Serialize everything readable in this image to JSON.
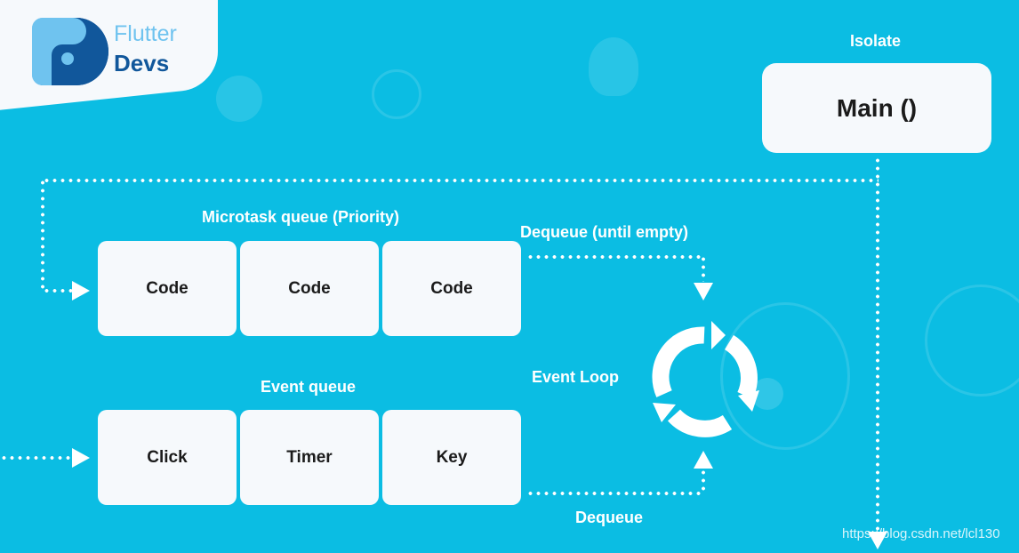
{
  "logo": {
    "line1": "Flutter",
    "line2": "Devs"
  },
  "isolate": {
    "label": "Isolate",
    "main": "Main ()"
  },
  "microtask": {
    "title": "Microtask queue (Priority)",
    "items": [
      "Code",
      "Code",
      "Code"
    ],
    "dequeue_label": "Dequeue (until empty)"
  },
  "event": {
    "title": "Event queue",
    "items": [
      "Click",
      "Timer",
      "Key"
    ],
    "dequeue_label": "Dequeue"
  },
  "event_loop": {
    "label": "Event Loop"
  },
  "watermark": "https://blog.csdn.net/lcl130",
  "colors": {
    "background": "#0bbde3",
    "box": "#f6f9fc",
    "logo_dark": "#11579b",
    "logo_light": "#6fc3ef"
  }
}
